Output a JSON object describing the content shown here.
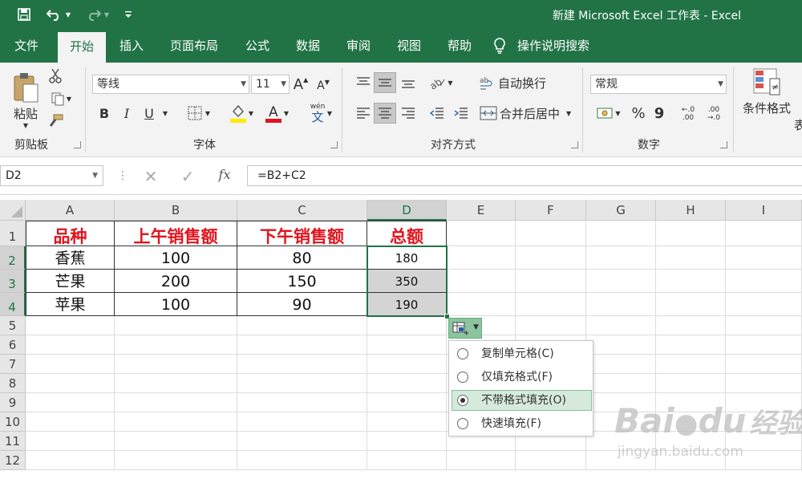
{
  "window": {
    "title": "新建 Microsoft Excel 工作表  -  Excel"
  },
  "tabs": [
    "文件",
    "开始",
    "插入",
    "页面布局",
    "公式",
    "数据",
    "审阅",
    "视图",
    "帮助"
  ],
  "tell_me": "操作说明搜索",
  "ribbon": {
    "clipboard": {
      "paste": "粘贴",
      "label": "剪贴板"
    },
    "font": {
      "name": "等线",
      "size": "11",
      "label": "字体",
      "bold": "B",
      "italic": "I",
      "underline": "U",
      "wen": "wén",
      "wen_char": "文"
    },
    "alignment": {
      "wrap": "自动换行",
      "merge": "合并后居中",
      "label": "对齐方式"
    },
    "number": {
      "format": "常规",
      "percent": "%",
      "comma": "9",
      "inc_decimal": "←.0\n.00",
      "dec_decimal": ".00\n→.0",
      "label": "数字"
    },
    "styles": {
      "conditional": "条件格式",
      "table_partial": "表"
    }
  },
  "formula_bar": {
    "name_box": "D2",
    "fx": "fx",
    "formula": "=B2+C2"
  },
  "sheet": {
    "columns": [
      "A",
      "B",
      "C",
      "D",
      "E",
      "F",
      "G",
      "H",
      "I"
    ],
    "rows": [
      "1",
      "2",
      "3",
      "4",
      "5",
      "6",
      "7",
      "8",
      "9",
      "10",
      "11",
      "12"
    ],
    "table_headers": [
      "品种",
      "上午销售额",
      "下午销售额",
      "总额"
    ],
    "table_rows": [
      [
        "香蕉",
        "100",
        "80",
        "180"
      ],
      [
        "芒果",
        "200",
        "150",
        "350"
      ],
      [
        "苹果",
        "100",
        "90",
        "190"
      ]
    ],
    "active_cell": "D2"
  },
  "autofill_menu": {
    "items": [
      "复制单元格(C)",
      "仅填充格式(F)",
      "不带格式填充(O)",
      "快速填充(F)"
    ],
    "selected_index": 2
  },
  "watermark": {
    "brand": "Bai",
    "brand2": "du",
    "cn": "经验",
    "url": "jingyan.baidu.com"
  }
}
